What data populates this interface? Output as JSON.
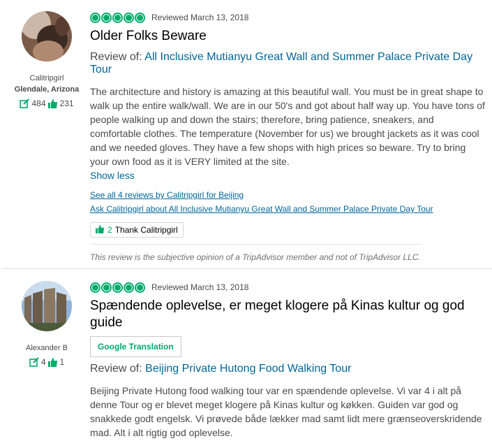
{
  "reviews": [
    {
      "username": "Calitripgirl",
      "location": "Glendale, Arizona",
      "review_count": "484",
      "helpful_count": "231",
      "rating": 5,
      "reviewed_date": "Reviewed March 13, 2018",
      "title": "Older Folks Beware",
      "review_of_label": "Review of:",
      "review_of_link": "All Inclusive Mutianyu Great Wall and Summer Palace Private Day Tour",
      "body": "The architecture and history is amazing at this beautiful wall. You must be in great shape to walk up the entire walk/wall. We are in our 50's and got about half way up. You have tons of people walking up and down the stairs; therefore, bring patience, sneakers, and comfortable clothes. The temperature (November for us) we brought jackets as it was cool and we needed gloves. They have a few shops with high prices so beware. Try to bring your own food as it is VERY limited at the site.",
      "show_less": "Show less",
      "see_all_link": "See all 4 reviews by Calitripgirl for Beijing",
      "ask_link": "Ask Calitripgirl about All Inclusive Mutianyu Great Wall and Summer Palace Private Day Tour",
      "thank_count": "2",
      "thank_label": "Thank Calitripgirl",
      "disclaimer": "This review is the subjective opinion of a TripAdvisor member and not of TripAdvisor LLC."
    },
    {
      "username": "Alexander B",
      "review_count": "4",
      "helpful_count": "1",
      "rating": 5,
      "reviewed_date": "Reviewed March 13, 2018",
      "title": "Spændende oplevelse, er meget klogere på Kinas kultur og god guide",
      "translate_button": "Google Translation",
      "review_of_label": "Review of:",
      "review_of_link": "Beijing Private Hutong Food Walking Tour",
      "body": "Beijing Private Hutong food walking tour var en spændende oplevelse. Vi var 4 i alt på denne Tour og er blevet meget klogere på Kinas kultur og køkken. Guiden var god og snakkede godt engelsk. Vi prøvede både lækker mad samt lidt mere grænseoverskridende mad. Alt i alt rigtig god oplevelse."
    }
  ],
  "colors": {
    "accent_green": "#00aa6c",
    "link_blue": "#006699"
  },
  "icons": {
    "review_count": "review-pencil-icon",
    "helpful": "thumbs-up-icon"
  }
}
